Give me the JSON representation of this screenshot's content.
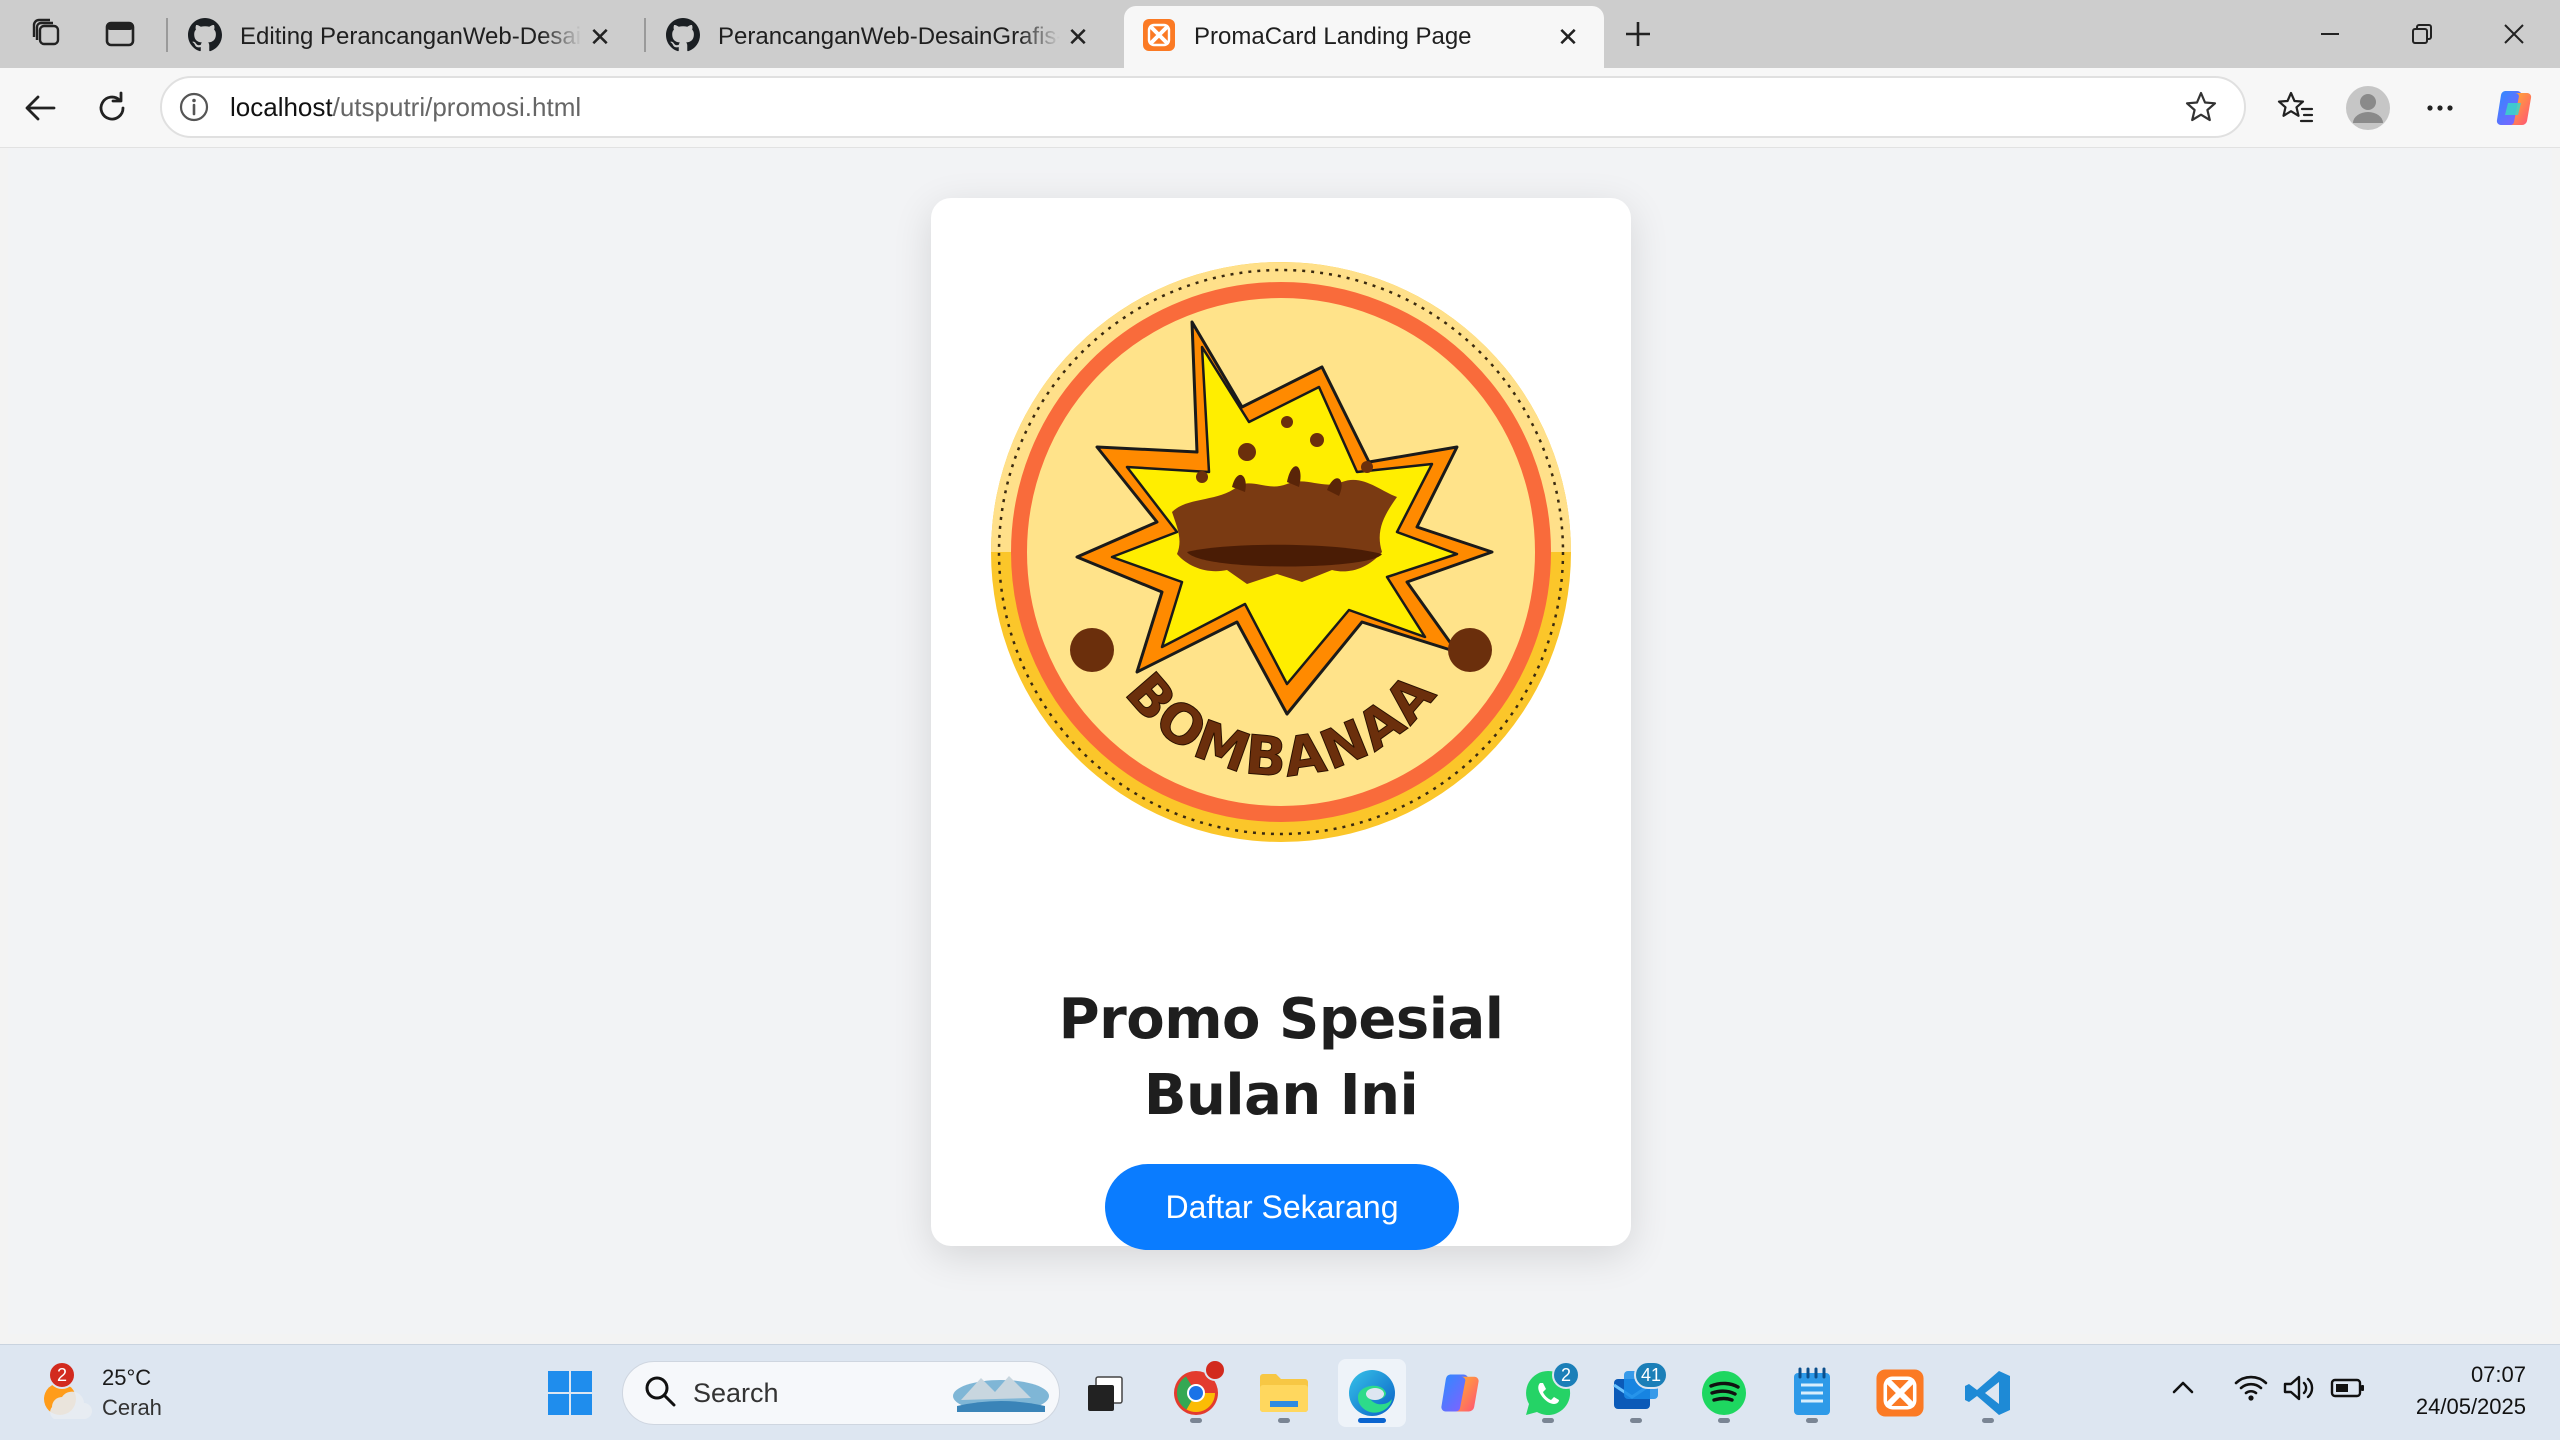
{
  "browser": {
    "tabs": [
      {
        "title": "Editing PerancanganWeb-DesainGrafis-Bombanaa",
        "favicon": "github-icon",
        "active": false
      },
      {
        "title": "PerancanganWeb-DesainGrafis-Bombanaa",
        "favicon": "github-icon",
        "active": false
      },
      {
        "title": "PromaCard Landing Page",
        "favicon": "xampp-icon",
        "active": true
      }
    ],
    "address": {
      "host": "localhost",
      "path": "/utsputri/promosi.html"
    }
  },
  "page": {
    "logo": {
      "text": "BOMBANAA",
      "colors": {
        "ring": "#f96b3b",
        "fill": "#ffe38a",
        "outer": "#fbc62a",
        "burst": "#ffe600",
        "choco": "#6b2f0c"
      }
    },
    "headline": "Promo Spesial Bulan Ini",
    "cta_label": "Daftar Sekarang",
    "accent": "#0a7cff"
  },
  "taskbar": {
    "weather": {
      "temp": "25°C",
      "condition": "Cerah",
      "badge": "2"
    },
    "search_placeholder": "Search",
    "badges": {
      "chrome": "",
      "whatsapp": "2",
      "mail": "41"
    },
    "clock": {
      "time": "07:07",
      "date": "24/05/2025"
    }
  }
}
